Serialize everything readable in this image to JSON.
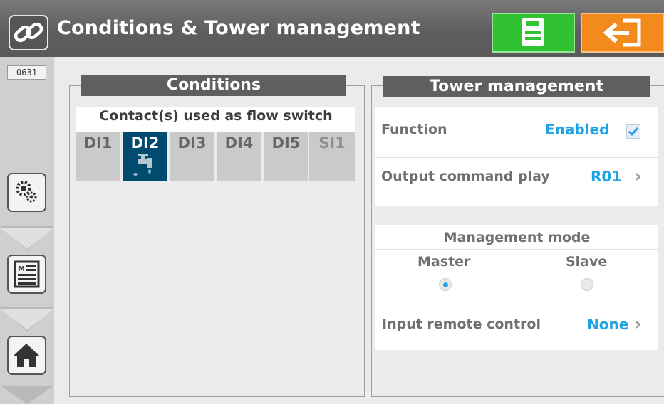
{
  "header": {
    "title": "Conditions & Tower management",
    "logo_icon": "link-icon",
    "save_icon": "save-icon",
    "exit_icon": "exit-icon",
    "save_color": "#31c231",
    "exit_color": "#f28a1c"
  },
  "sidebar": {
    "code": "0631",
    "items": [
      {
        "icon": "settings-icon"
      },
      {
        "icon": "manual-icon"
      },
      {
        "icon": "home-icon"
      }
    ]
  },
  "conditions": {
    "title": "Conditions",
    "flow_switch_label": "Contact(s) used as flow switch",
    "contacts": [
      {
        "label": "DI1",
        "selected": false
      },
      {
        "label": "DI2",
        "selected": true,
        "icon": "faucet-icon"
      },
      {
        "label": "DI3",
        "selected": false
      },
      {
        "label": "DI4",
        "selected": false
      },
      {
        "label": "DI5",
        "selected": false
      },
      {
        "label": "SI1",
        "selected": false,
        "disabled": true
      }
    ]
  },
  "tower": {
    "title": "Tower management",
    "function_label": "Function",
    "function_value": "Enabled",
    "function_checked": true,
    "output_label": "Output command play",
    "output_value": "R01",
    "mode_title": "Management mode",
    "master_label": "Master",
    "slave_label": "Slave",
    "selected_mode": "Master",
    "remote_label": "Input remote control",
    "remote_value": "None"
  },
  "colors": {
    "accent_blue": "#1ea3e6",
    "selected_tile": "#004b6e",
    "titlebar": "#666666"
  }
}
